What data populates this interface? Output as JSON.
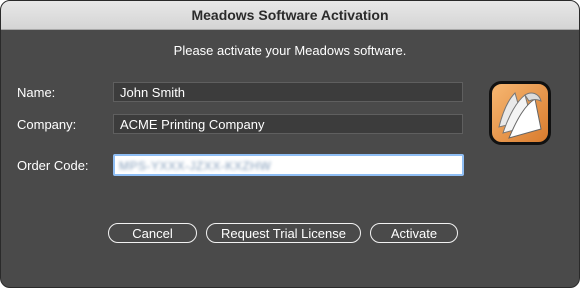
{
  "window": {
    "title": "Meadows Software Activation"
  },
  "prompt": "Please activate your Meadows software.",
  "form": {
    "name_label": "Name:",
    "name_value": "John Smith",
    "company_label": "Company:",
    "company_value": "ACME Printing Company",
    "order_code_label": "Order Code:",
    "order_code_value": "MPS-YXXX-JZXX-KXZHW"
  },
  "buttons": {
    "cancel": "Cancel",
    "request_trial": "Request Trial License",
    "activate": "Activate"
  },
  "icons": {
    "app_logo": "app-logo-icon"
  },
  "colors": {
    "window_bg": "#4a4a4a",
    "focus_ring": "#8fbef4"
  }
}
